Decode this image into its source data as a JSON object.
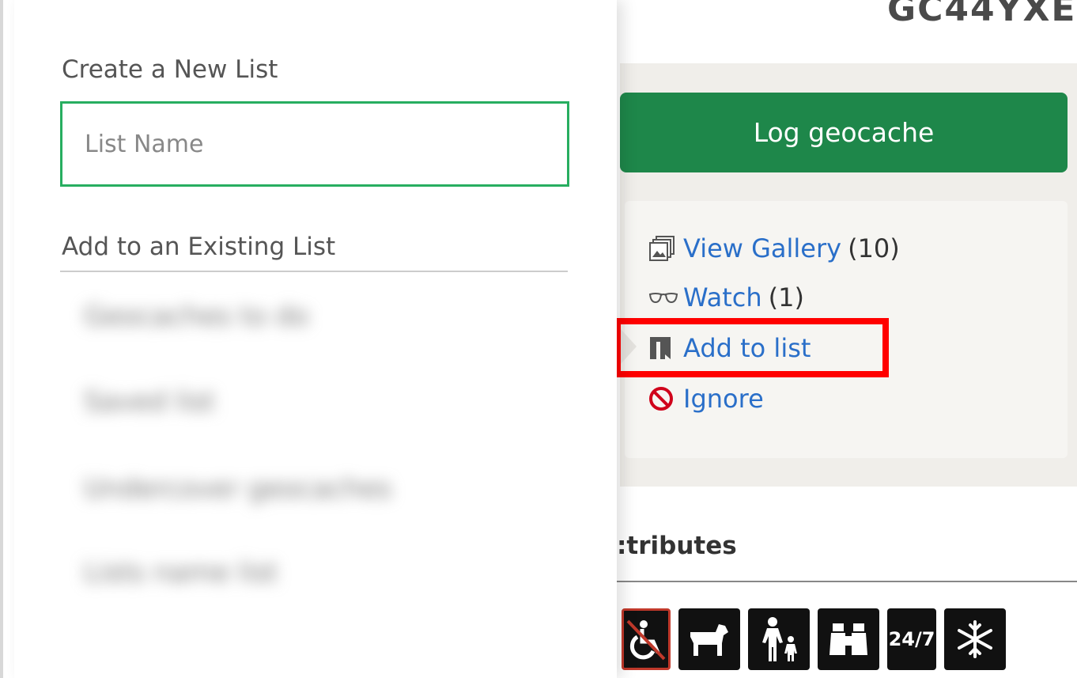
{
  "header": {
    "cache_code": "GC44YXE"
  },
  "primary_action": {
    "label": "Log geocache"
  },
  "actions": [
    {
      "label": "View Gallery",
      "count": "(10)",
      "icon": "gallery-icon"
    },
    {
      "label": "Watch",
      "count": "(1)",
      "icon": "glasses-icon"
    },
    {
      "label": "Add to list",
      "count": "",
      "icon": "bookmark-icon"
    },
    {
      "label": "Ignore",
      "count": "",
      "icon": "ban-icon"
    }
  ],
  "attributes": {
    "heading": ":tributes",
    "items": [
      {
        "icon": "wheelchair-not-accessible-icon"
      },
      {
        "icon": "dogs-allowed-icon"
      },
      {
        "icon": "kid-friendly-icon"
      },
      {
        "icon": "scenic-view-icon"
      },
      {
        "icon": "available-24-7-icon",
        "text": "24/7"
      },
      {
        "icon": "winter-icon"
      }
    ]
  },
  "list_panel": {
    "create_label": "Create a New List",
    "list_name_placeholder": "List Name",
    "existing_label": "Add to an Existing List",
    "existing_lists": [
      {
        "label": "Geocaches to do"
      },
      {
        "label": "Saved list"
      },
      {
        "label": "Undercover geocaches"
      },
      {
        "label": "Lists name list"
      }
    ]
  },
  "colors": {
    "log_button": "#1e874a",
    "link": "#2a6fc9",
    "input_border": "#27ae60",
    "highlight": "#ff0000"
  }
}
